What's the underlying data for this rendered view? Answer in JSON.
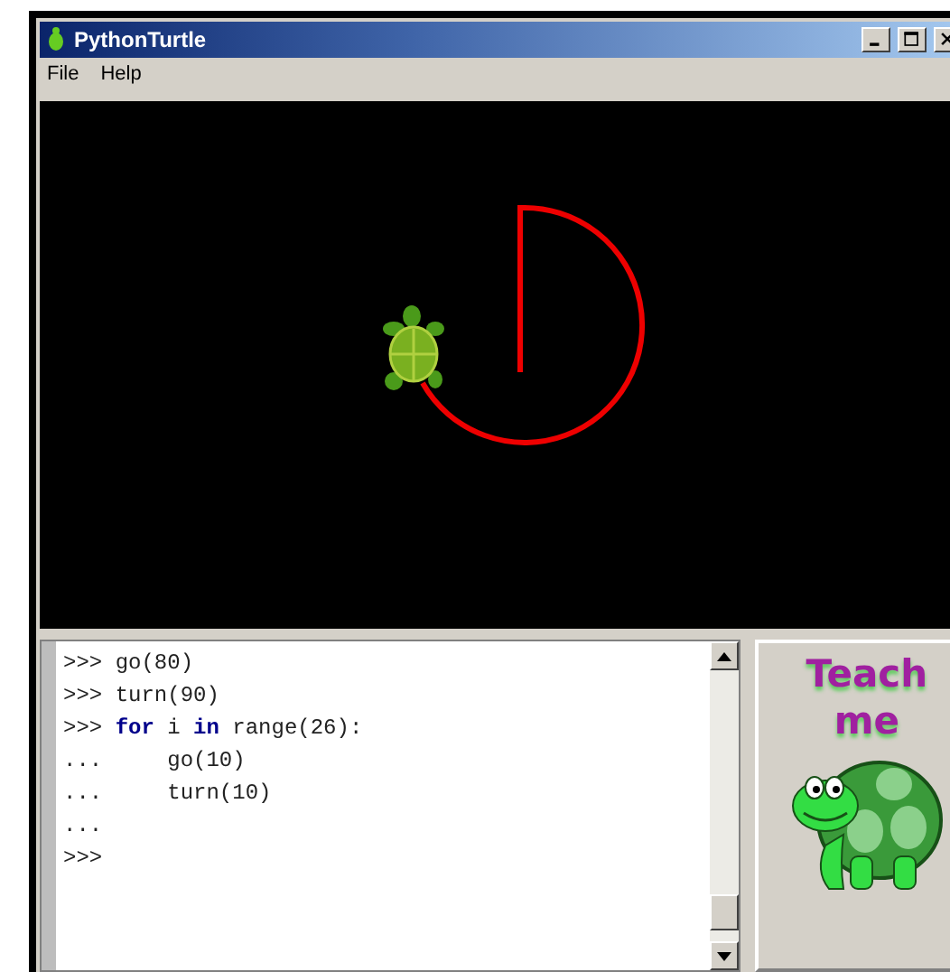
{
  "window": {
    "title": "PythonTurtle"
  },
  "menu": [
    {
      "label": "File"
    },
    {
      "label": "Help"
    }
  ],
  "shell": {
    "lines": [
      {
        "prompt": ">>>",
        "tokens": [
          {
            "text": "go(80)",
            "kind": "code"
          }
        ]
      },
      {
        "prompt": ">>>",
        "tokens": [
          {
            "text": "turn(90)",
            "kind": "code"
          }
        ]
      },
      {
        "prompt": ">>>",
        "tokens": [
          {
            "text": "for",
            "kind": "keyword"
          },
          {
            "text": " i ",
            "kind": "code"
          },
          {
            "text": "in",
            "kind": "keyword"
          },
          {
            "text": " range(26):",
            "kind": "code"
          }
        ]
      },
      {
        "prompt": "...",
        "tokens": [
          {
            "text": "    go(10)",
            "kind": "code"
          }
        ]
      },
      {
        "prompt": "...",
        "tokens": [
          {
            "text": "    turn(10)",
            "kind": "code"
          }
        ]
      },
      {
        "prompt": "..."
      },
      {
        "prompt": ">>>"
      }
    ]
  },
  "teach_button": {
    "label": "Teach me"
  }
}
